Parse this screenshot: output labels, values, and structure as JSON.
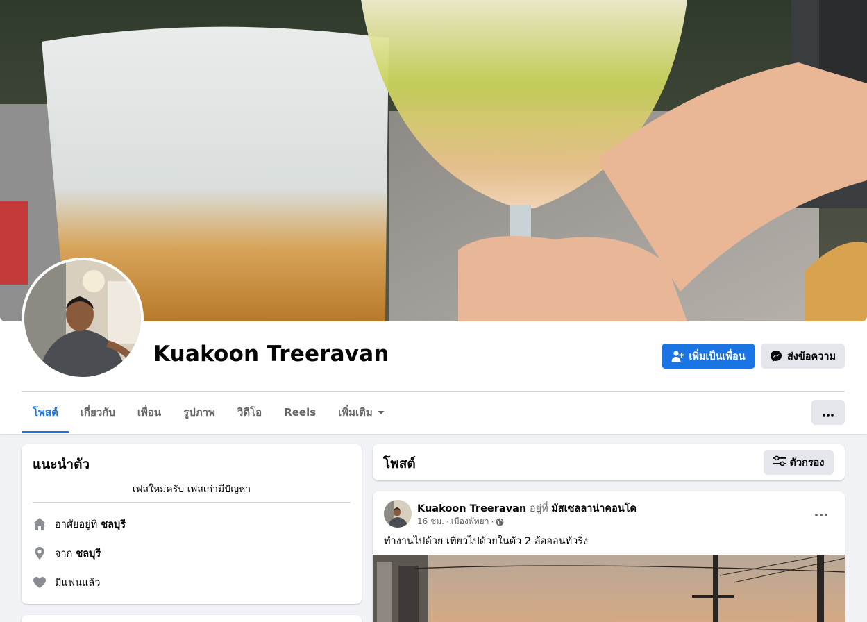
{
  "profile": {
    "name": "Kuakoon Treeravan",
    "add_friend_label": "เพิ่มเป็นเพื่อน",
    "message_label": "ส่งข้อความ"
  },
  "tabs": [
    {
      "label": "โพสต์"
    },
    {
      "label": "เกี่ยวกับ"
    },
    {
      "label": "เพื่อน"
    },
    {
      "label": "รูปภาพ"
    },
    {
      "label": "วิดีโอ"
    },
    {
      "label": "Reels"
    },
    {
      "label": "เพิ่มเติม"
    }
  ],
  "intro": {
    "title": "แนะนำตัว",
    "bio": "เฟสใหม่ครับ เฟสเก่ามีปัญหา",
    "lives_in_prefix": "อาศัยอยู่ที่",
    "lives_in_value": "ชลบุรี",
    "from_prefix": "จาก",
    "from_value": "ชลบุรี",
    "relationship": "มีแฟนแล้ว"
  },
  "posts_section": {
    "title": "โพสต์",
    "filter_label": "ตัวกรอง"
  },
  "post": {
    "author": "Kuakoon Treeravan",
    "at_text": "อยู่ที่",
    "place": "มัสเซลลาน่าคอนโด",
    "time": "16 ชม.",
    "location": "เมืองพัทยา",
    "text": "ทำงานไปด้วย เที่ยวไปด้วยในตัว 2 ล้อออนทัวริ่ง"
  },
  "colors": {
    "accent": "#1b74e4",
    "page_bg": "#f0f2f5",
    "secondary_button": "#e4e6eb",
    "muted_text": "#65676b"
  },
  "icons": {
    "add_friend": "person-plus-icon",
    "message": "messenger-icon",
    "dropdown": "caret-down-icon",
    "more": "more-dots-icon",
    "filter": "filter-sliders-icon",
    "home": "home-icon",
    "location": "location-pin-icon",
    "relationship": "heart-icon",
    "privacy": "globe-icon"
  }
}
